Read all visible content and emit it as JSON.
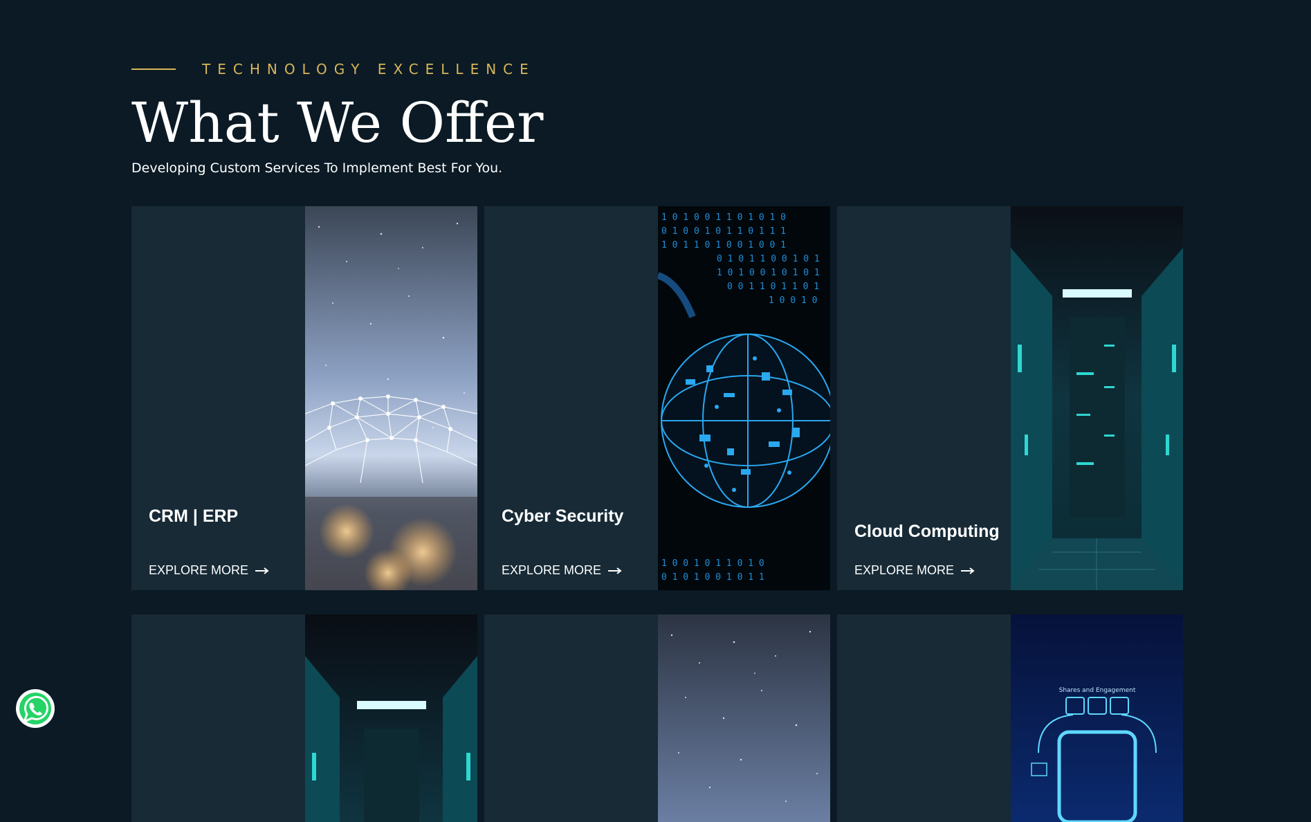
{
  "header": {
    "eyebrow": "TECHNOLOGY EXCELLENCE",
    "title": "What We Offer",
    "subtitle": "Developing Custom Services To Implement Best For You."
  },
  "cards": [
    {
      "title": "CRM | ERP",
      "link": "EXPLORE MORE",
      "image": "network-earth"
    },
    {
      "title": "Cyber Security",
      "link": "EXPLORE MORE",
      "image": "binary-globe"
    },
    {
      "title": "Cloud Computing",
      "link": "EXPLORE MORE",
      "image": "server-room"
    },
    {
      "title": "",
      "link": "",
      "image": "server-room"
    },
    {
      "title": "",
      "link": "",
      "image": "starfield"
    },
    {
      "title": "",
      "link": "",
      "image": "dashboard-hologram",
      "image_text": "Shares and Engagement"
    }
  ],
  "colors": {
    "background": "#0b1a24",
    "card": "#172a36",
    "accent_gold": "#d9b65c",
    "whatsapp_green": "#25d366"
  },
  "floating": {
    "whatsapp_icon": "whatsapp-icon"
  }
}
